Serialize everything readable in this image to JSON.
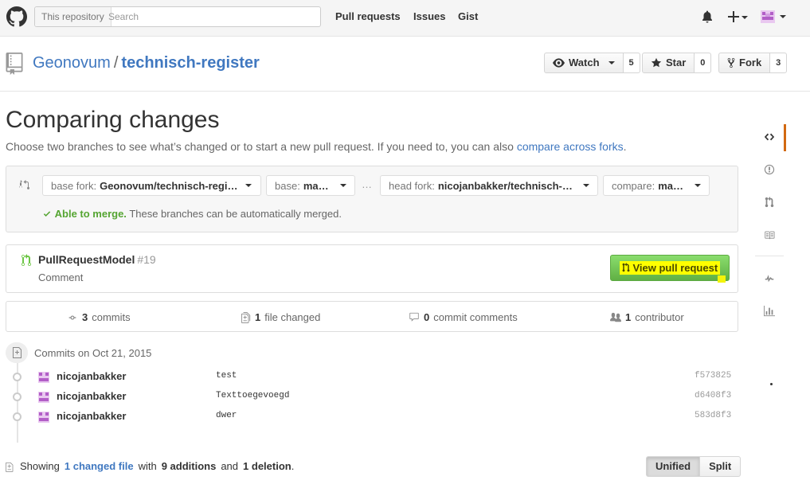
{
  "header": {
    "search_scope": "This repository",
    "search_placeholder": "Search",
    "nav": [
      "Pull requests",
      "Issues",
      "Gist"
    ]
  },
  "repo": {
    "owner": "Geonovum",
    "separator": "/",
    "name": "technisch-register",
    "watch_label": "Watch",
    "watch_count": "5",
    "star_label": "Star",
    "star_count": "0",
    "fork_label": "Fork",
    "fork_count": "3"
  },
  "compare": {
    "title": "Comparing changes",
    "description_prefix": "Choose two branches to see what’s changed or to start a new pull request. If you need to, you can also ",
    "description_link": "compare across forks",
    "description_suffix": ".",
    "base_fork_label": "base fork:",
    "base_fork_value": "Geonovum/technisch-regi…",
    "base_label": "base:",
    "base_value": "master",
    "ellipsis": "…",
    "head_fork_label": "head fork:",
    "head_fork_value": "nicojanbakker/technisch-r…",
    "compare_label": "compare:",
    "compare_value": "master",
    "merge_status": "Able to merge.",
    "merge_message": "These branches can be automatically merged."
  },
  "pull_request": {
    "title": "PullRequestModel",
    "number": "#19",
    "description": "Comment",
    "button_label": "View pull request"
  },
  "summary": {
    "commits_count": "3",
    "commits_label": "commits",
    "files_count": "1",
    "files_label": "file changed",
    "comments_count": "0",
    "comments_label": "commit comments",
    "contributors_count": "1",
    "contributors_label": "contributor"
  },
  "commits": {
    "date_heading": "Commits on Oct 21, 2015",
    "rows": [
      {
        "author": "nicojanbakker",
        "message": "test",
        "sha": "f573825"
      },
      {
        "author": "nicojanbakker",
        "message": "Texttoegevoegd",
        "sha": "d6408f3"
      },
      {
        "author": "nicojanbakker",
        "message": "dwer",
        "sha": "583d8f3"
      }
    ]
  },
  "toc": {
    "showing": "Showing",
    "changed_link": "1 changed file",
    "with": "with",
    "additions": "9 additions",
    "and": "and",
    "deletions": "1 deletion",
    "period": "."
  },
  "view_toggle": {
    "unified": "Unified",
    "split": "Split"
  },
  "colors": {
    "link": "#4078c0",
    "merge_ok": "#55a532",
    "pr_button": "#60b044",
    "highlight": "#ffff00",
    "sidebar_selected": "#d26911"
  }
}
